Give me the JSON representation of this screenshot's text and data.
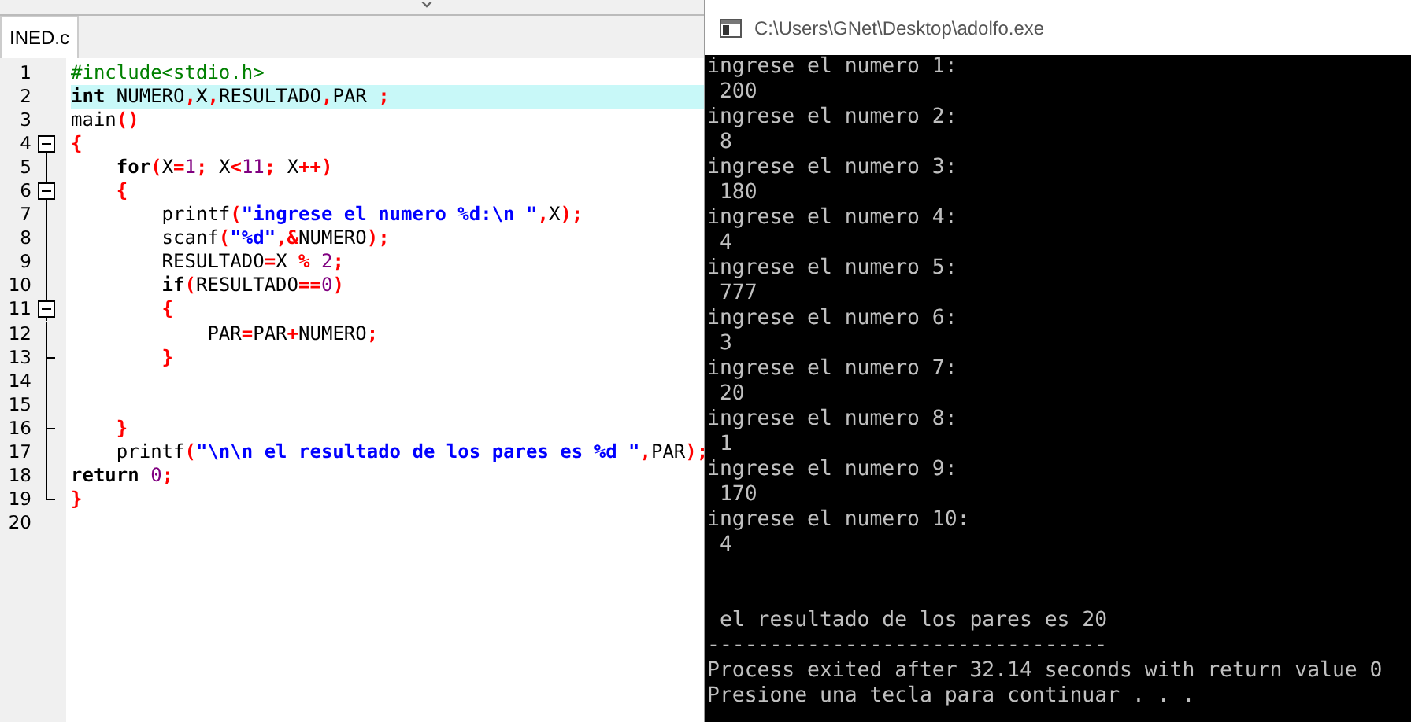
{
  "editor": {
    "tab": {
      "label": "INED.c",
      "selected": true
    },
    "lines": [
      {
        "number": "1",
        "kind": "plain",
        "tokens": [
          {
            "text": "#include<stdio.h>",
            "kind": "pre"
          }
        ]
      },
      {
        "number": "2",
        "kind": "plain",
        "current": true,
        "tokens": [
          {
            "text": "int",
            "kind": "kw"
          },
          {
            "text": " NUMERO",
            "kind": "id"
          },
          {
            "text": ",",
            "kind": "sym"
          },
          {
            "text": "X",
            "kind": "id"
          },
          {
            "text": ",",
            "kind": "sym"
          },
          {
            "text": "RESULTADO",
            "kind": "id"
          },
          {
            "text": ",",
            "kind": "sym"
          },
          {
            "text": "PAR ",
            "kind": "id"
          },
          {
            "text": ";",
            "kind": "sym"
          }
        ]
      },
      {
        "number": "3",
        "kind": "plain",
        "tokens": [
          {
            "text": "main",
            "kind": "id"
          },
          {
            "text": "()",
            "kind": "sym"
          }
        ]
      },
      {
        "number": "4",
        "kind": "fold-open",
        "tokens": [
          {
            "text": "{",
            "kind": "sym"
          }
        ]
      },
      {
        "number": "5",
        "kind": "fold-line",
        "tokens": [
          {
            "text": "    for",
            "kind": "kw"
          },
          {
            "text": "(",
            "kind": "sym"
          },
          {
            "text": "X",
            "kind": "id"
          },
          {
            "text": "=",
            "kind": "sym"
          },
          {
            "text": "1",
            "kind": "num"
          },
          {
            "text": "; ",
            "kind": "sym"
          },
          {
            "text": "X",
            "kind": "id"
          },
          {
            "text": "<",
            "kind": "sym"
          },
          {
            "text": "11",
            "kind": "num"
          },
          {
            "text": "; ",
            "kind": "sym"
          },
          {
            "text": "X",
            "kind": "id"
          },
          {
            "text": "++)",
            "kind": "sym"
          }
        ]
      },
      {
        "number": "6",
        "kind": "fold-open",
        "tokens": [
          {
            "text": "    {",
            "kind": "sym"
          }
        ]
      },
      {
        "number": "7",
        "kind": "fold-line",
        "tokens": [
          {
            "text": "        printf",
            "kind": "id"
          },
          {
            "text": "(",
            "kind": "sym"
          },
          {
            "text": "\"ingrese el numero %d:\\n \"",
            "kind": "str"
          },
          {
            "text": ",",
            "kind": "sym"
          },
          {
            "text": "X",
            "kind": "id"
          },
          {
            "text": ");",
            "kind": "sym"
          }
        ]
      },
      {
        "number": "8",
        "kind": "fold-line",
        "tokens": [
          {
            "text": "        scanf",
            "kind": "id"
          },
          {
            "text": "(",
            "kind": "sym"
          },
          {
            "text": "\"%d\"",
            "kind": "str"
          },
          {
            "text": ",&",
            "kind": "sym"
          },
          {
            "text": "NUMERO",
            "kind": "id"
          },
          {
            "text": ");",
            "kind": "sym"
          }
        ]
      },
      {
        "number": "9",
        "kind": "fold-line",
        "tokens": [
          {
            "text": "        RESULTADO",
            "kind": "id"
          },
          {
            "text": "=",
            "kind": "sym"
          },
          {
            "text": "X ",
            "kind": "id"
          },
          {
            "text": "%",
            "kind": "sym"
          },
          {
            "text": " 2",
            "kind": "num"
          },
          {
            "text": ";",
            "kind": "sym"
          }
        ]
      },
      {
        "number": "10",
        "kind": "fold-line",
        "tokens": [
          {
            "text": "        if",
            "kind": "kw"
          },
          {
            "text": "(",
            "kind": "sym"
          },
          {
            "text": "RESULTADO",
            "kind": "id"
          },
          {
            "text": "==",
            "kind": "sym"
          },
          {
            "text": "0",
            "kind": "num"
          },
          {
            "text": ")",
            "kind": "sym"
          }
        ]
      },
      {
        "number": "11",
        "kind": "fold-open",
        "tokens": [
          {
            "text": "        {",
            "kind": "sym"
          }
        ]
      },
      {
        "number": "12",
        "kind": "fold-line",
        "tokens": [
          {
            "text": "            PAR",
            "kind": "id"
          },
          {
            "text": "=",
            "kind": "sym"
          },
          {
            "text": "PAR",
            "kind": "id"
          },
          {
            "text": "+",
            "kind": "sym"
          },
          {
            "text": "NUMERO",
            "kind": "id"
          },
          {
            "text": ";",
            "kind": "sym"
          }
        ]
      },
      {
        "number": "13",
        "kind": "fold-end",
        "tokens": [
          {
            "text": "        }",
            "kind": "sym"
          }
        ]
      },
      {
        "number": "14",
        "kind": "fold-line"
      },
      {
        "number": "15",
        "kind": "fold-line"
      },
      {
        "number": "16",
        "kind": "fold-end",
        "tokens": [
          {
            "text": "    }",
            "kind": "sym"
          }
        ]
      },
      {
        "number": "17",
        "kind": "fold-line",
        "tokens": [
          {
            "text": "    printf",
            "kind": "id"
          },
          {
            "text": "(",
            "kind": "sym"
          },
          {
            "text": "\"\\n\\n el resultado de los pares es %d \"",
            "kind": "str"
          },
          {
            "text": ",",
            "kind": "sym"
          },
          {
            "text": "PAR",
            "kind": "id"
          },
          {
            "text": ");",
            "kind": "sym"
          }
        ]
      },
      {
        "number": "18",
        "kind": "fold-line",
        "tokens": [
          {
            "text": "return ",
            "kind": "kw"
          },
          {
            "text": "0",
            "kind": "num"
          },
          {
            "text": ";",
            "kind": "sym"
          }
        ]
      },
      {
        "number": "19",
        "kind": "fold-last",
        "tokens": [
          {
            "text": "}",
            "kind": "sym"
          }
        ]
      },
      {
        "number": "20",
        "kind": "plain"
      }
    ]
  },
  "console": {
    "title": "C:\\Users\\GNet\\Desktop\\adolfo.exe",
    "output": [
      "ingrese el numero 1:",
      " 200",
      "ingrese el numero 2:",
      " 8",
      "ingrese el numero 3:",
      " 180",
      "ingrese el numero 4:",
      " 4",
      "ingrese el numero 5:",
      " 777",
      "ingrese el numero 6:",
      " 3",
      "ingrese el numero 7:",
      " 20",
      "ingrese el numero 8:",
      " 1",
      "ingrese el numero 9:",
      " 170",
      "ingrese el numero 10:",
      " 4"
    ],
    "summary": [
      " el resultado de los pares es 20",
      "--------------------------------",
      "Process exited after 32.14 seconds with return value 0",
      "Presione una tecla para continuar . . ."
    ]
  }
}
